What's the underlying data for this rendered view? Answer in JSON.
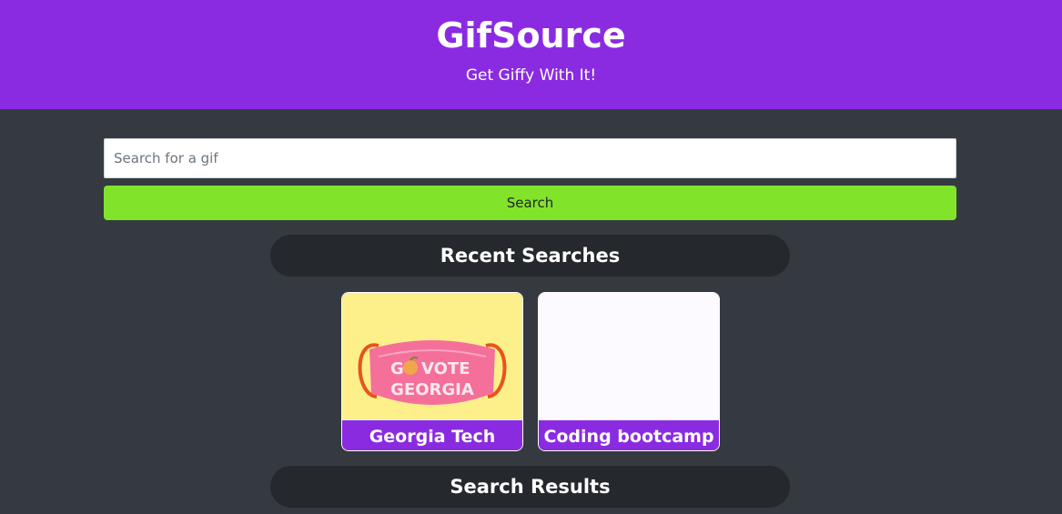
{
  "header": {
    "title": "GifSource",
    "subtitle": "Get Giffy With It!"
  },
  "search": {
    "placeholder": "Search for a gif",
    "value": "",
    "button_label": "Search"
  },
  "recent": {
    "heading": "Recent Searches",
    "items": [
      {
        "label": "Georgia Tech",
        "gif_text_line1": "G",
        "gif_text_line1b": "VOTE",
        "gif_text_line2": "GEORGIA"
      },
      {
        "label": "Coding bootcamp"
      }
    ]
  },
  "results": {
    "heading": "Search Results"
  },
  "colors": {
    "header_bg": "#8a2be2",
    "page_bg": "#343a40",
    "button_bg": "#82e32b",
    "pill_bg": "#25282c"
  }
}
